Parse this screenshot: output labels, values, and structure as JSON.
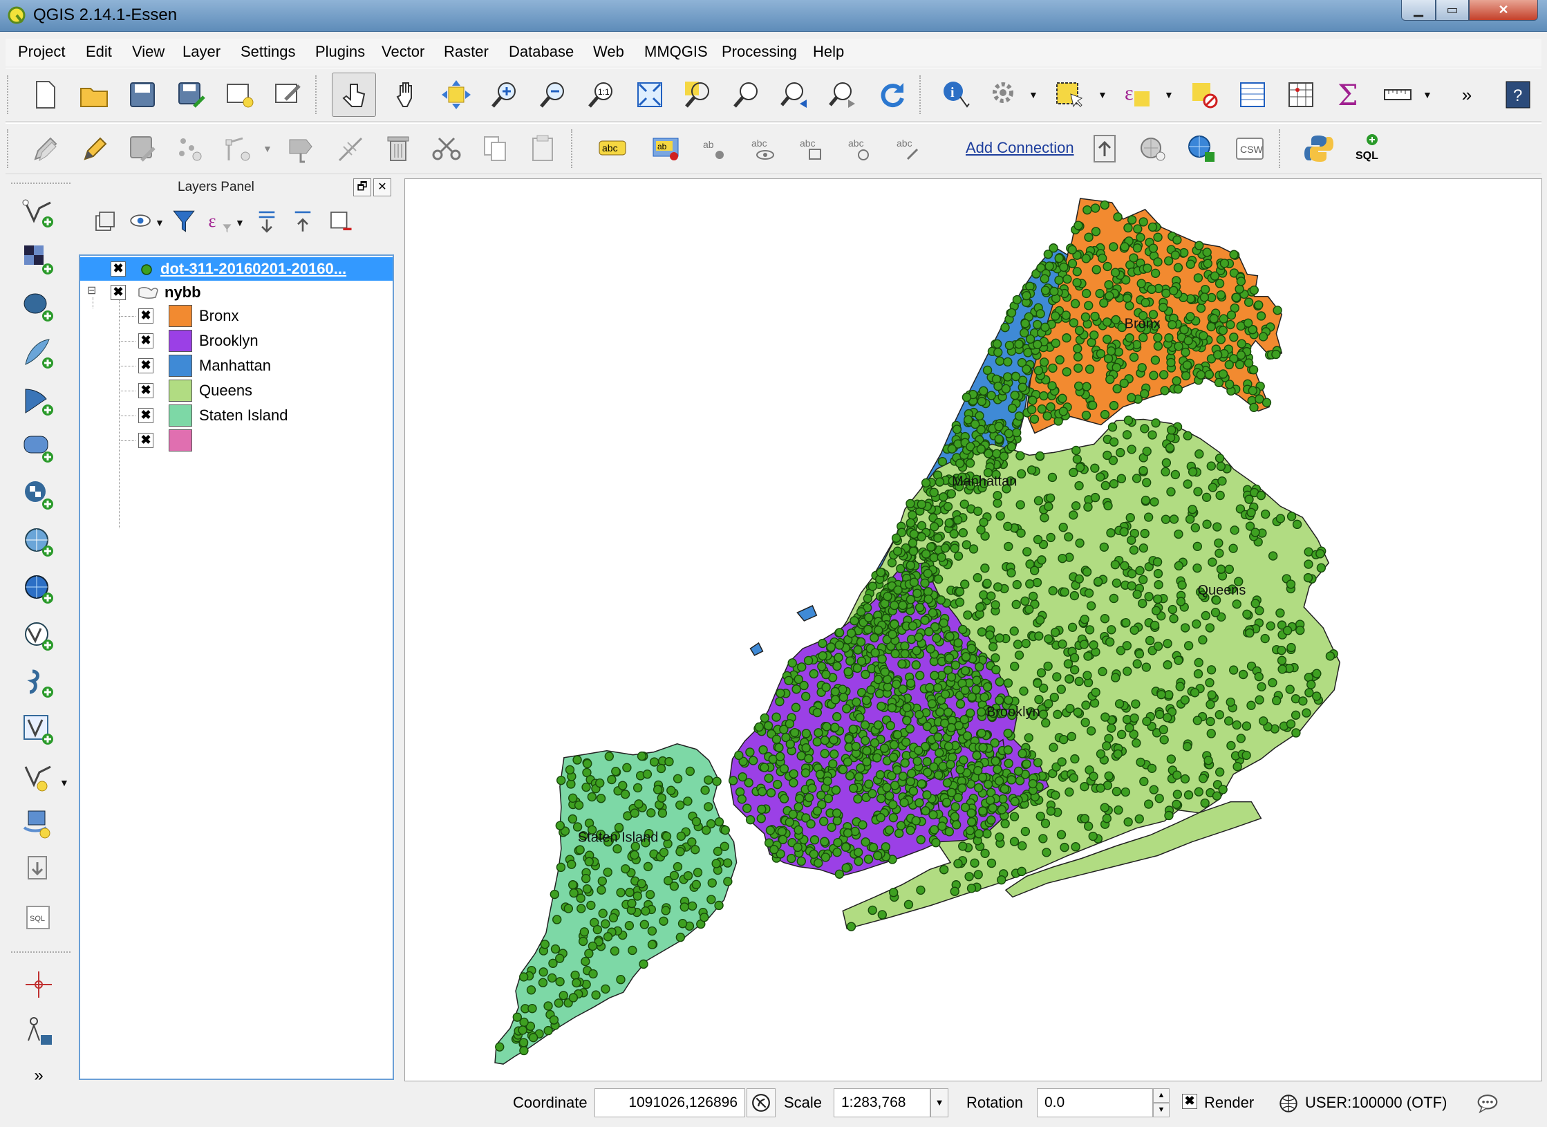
{
  "window": {
    "title": "QGIS 2.14.1-Essen",
    "minimize": "▁",
    "maximize": "▭",
    "close": "✕"
  },
  "menu": [
    "Project",
    "Edit",
    "View",
    "Layer",
    "Settings",
    "Plugins",
    "Vector",
    "Raster",
    "Database",
    "Web",
    "MMQGIS",
    "Processing",
    "Help"
  ],
  "toolbar2": {
    "add_connection": "Add Connection",
    "csw": "CSW",
    "sql": "SQL",
    "more": "»"
  },
  "layers_panel": {
    "title": "Layers Panel",
    "float": "🗗",
    "close": "✕",
    "layers": [
      {
        "name": "dot-311-20160201-20160...",
        "checked": "✖",
        "selected": true
      },
      {
        "name": "nybb",
        "checked": "✖",
        "expanded": "⊟"
      }
    ],
    "categories": [
      {
        "label": "Bronx",
        "color": "#f28a30",
        "checked": "✖"
      },
      {
        "label": "Brooklyn",
        "color": "#9b40e6",
        "checked": "✖"
      },
      {
        "label": "Manhattan",
        "color": "#3f8ad6",
        "checked": "✖"
      },
      {
        "label": "Queens",
        "color": "#b1dc82",
        "checked": "✖"
      },
      {
        "label": "Staten Island",
        "color": "#7dd8a6",
        "checked": "✖"
      },
      {
        "label": "",
        "color": "#e06fb0",
        "checked": "✖"
      }
    ]
  },
  "map": {
    "labels": {
      "bronx": "Bronx",
      "manhattan": "Manhattan",
      "queens": "Queens",
      "brooklyn": "Brooklyn",
      "staten_island": "Staten Island"
    },
    "point_color": "#3ea021",
    "point_stroke": "#174a0b"
  },
  "status": {
    "coordinate_label": "Coordinate",
    "coordinate_value": "1091026,126896",
    "scale_label": "Scale",
    "scale_value": "1:283,768",
    "rotation_label": "Rotation",
    "rotation_value": "0.0",
    "render_label": "Render",
    "render_checked": "✖",
    "crs": "USER:100000 (OTF)"
  }
}
